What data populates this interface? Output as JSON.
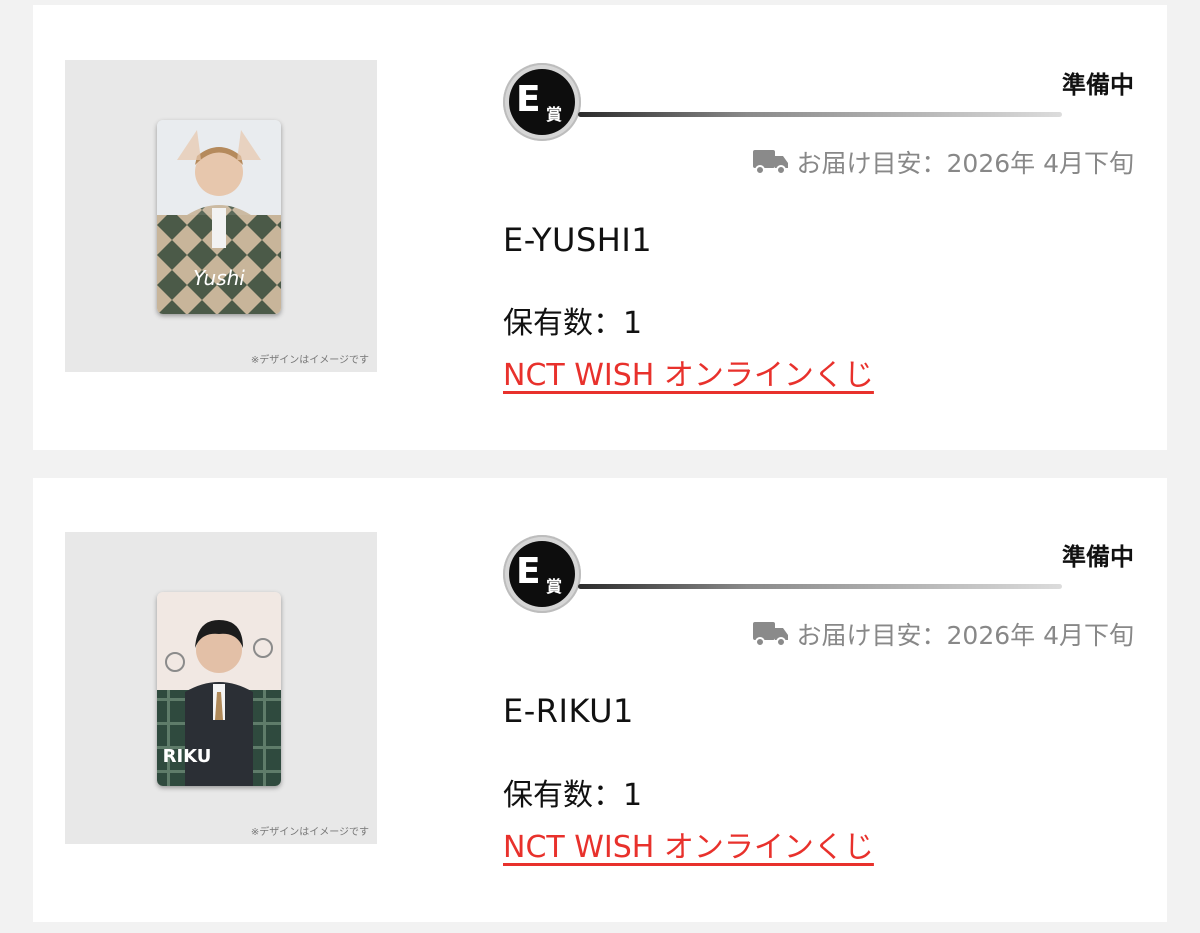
{
  "items": [
    {
      "prize_letter": "E",
      "prize_kanji": "賞",
      "status": "準備中",
      "delivery_text": "お届け目安：2026年 4月下旬",
      "item_name": "E-YUSHI1",
      "quantity_text": "保有数：1",
      "link_text": "NCT WISH オンラインくじ",
      "image_caption": "※デザインはイメージです",
      "card_name_text": "Yushi",
      "card_theme": "argyle-green-tan"
    },
    {
      "prize_letter": "E",
      "prize_kanji": "賞",
      "status": "準備中",
      "delivery_text": "お届け目安：2026年 4月下旬",
      "item_name": "E-RIKU1",
      "quantity_text": "保有数：1",
      "link_text": "NCT WISH オンラインくじ",
      "image_caption": "※デザインはイメージです",
      "card_name_text": "RIKU",
      "card_theme": "plaid-green-sample"
    }
  ],
  "colors": {
    "page_bg": "#f2f2f2",
    "card_bg": "#ffffff",
    "link_red": "#e8312c",
    "muted_gray": "#888888",
    "badge_black": "#0d0d0d"
  },
  "icons": {
    "delivery": "truck-icon"
  }
}
